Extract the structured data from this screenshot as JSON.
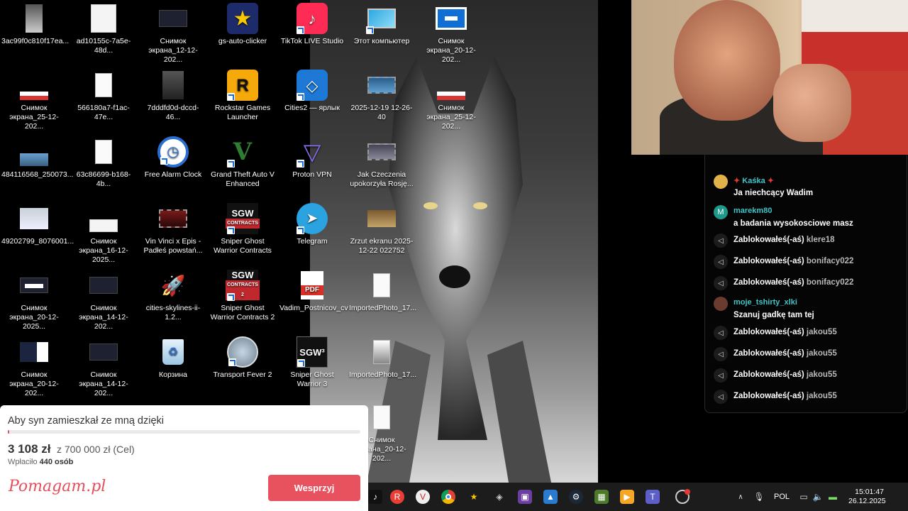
{
  "desktop": {
    "icons": [
      {
        "label": "3ac99f0c810f17ea..."
      },
      {
        "label": "ad10155c-7a5e-48d..."
      },
      {
        "label": "Снимок экрана_12-12-202..."
      },
      {
        "label": "gs-auto-clicker"
      },
      {
        "label": "TikTok LIVE Studio"
      },
      {
        "label": "Этот компьютер"
      },
      {
        "label": "Снимок экрана_20-12-202..."
      },
      {
        "label": "Снимок экрана_25-12-202..."
      },
      {
        "label": "566180a7-f1ac-47e..."
      },
      {
        "label": "7dddfd0d-dccd-46..."
      },
      {
        "label": "Rockstar Games Launcher"
      },
      {
        "label": "Cities2 — ярлык"
      },
      {
        "label": "2025-12-19 12-26-40"
      },
      {
        "label": "Снимок экрана_25-12-202..."
      },
      {
        "label": "484116568_250073..."
      },
      {
        "label": "63c86699-b168-4b..."
      },
      {
        "label": "Free Alarm Clock"
      },
      {
        "label": "Grand Theft Auto V Enhanced"
      },
      {
        "label": "Proton VPN"
      },
      {
        "label": "Jak Czeczenia upokorzyła Rosję..."
      },
      {
        "label": "49202799_8076001..."
      },
      {
        "label": "Снимок экрана_16-12-2025..."
      },
      {
        "label": "Vin Vinci x Epis - Padłeś powstań..."
      },
      {
        "label": "Sniper Ghost Warrior Contracts"
      },
      {
        "label": "Telegram"
      },
      {
        "label": "Zrzut ekranu 2025-12-22 022752"
      },
      {
        "label": "Снимок экрана_20-12-2025..."
      },
      {
        "label": "Снимок экрана_14-12-202..."
      },
      {
        "label": "cities-skylines-ii-1.2..."
      },
      {
        "label": "Sniper Ghost Warrior Contracts 2"
      },
      {
        "label": "Vadim_Postnicov_cv"
      },
      {
        "label": "ImportedPhoto_17..."
      },
      {
        "label": "Снимок экрана_20-12-202..."
      },
      {
        "label": "Снимок экрана_14-12-202..."
      },
      {
        "label": "Корзина"
      },
      {
        "label": "Transport Fever 2"
      },
      {
        "label": "Sniper Ghost Warrior 3"
      },
      {
        "label": "ImportedPhoto_17..."
      },
      {
        "label": "Снимок экрана_20-12-202..."
      }
    ]
  },
  "chat": {
    "messages": [
      {
        "kind": "msg",
        "user": "Kaśka",
        "text": "Ja niechcący Wadim",
        "avatar_color": "#e2b24a"
      },
      {
        "kind": "msg",
        "user": "marekm80",
        "text": "a badania wysokosciowe masz",
        "avatar_letter": "M",
        "avatar_color": "#1f9a8a"
      },
      {
        "kind": "sys",
        "text": "Zablokowałeś(-aś)",
        "target": "klere18"
      },
      {
        "kind": "sys",
        "text": "Zablokowałeś(-aś)",
        "target": "bonifacy022"
      },
      {
        "kind": "sys",
        "text": "Zablokowałeś(-aś)",
        "target": "bonifacy022"
      },
      {
        "kind": "msg",
        "user": "moje_tshirty_xlki",
        "text": "Szanuj gadkę tam tej",
        "avatar_color": "#6b3b2f"
      },
      {
        "kind": "sys",
        "text": "Zablokowałeś(-aś)",
        "target": "jakou55"
      },
      {
        "kind": "sys",
        "text": "Zablokowałeś(-aś)",
        "target": "jakou55"
      },
      {
        "kind": "sys",
        "text": "Zablokowałeś(-aś)",
        "target": "jakou55"
      },
      {
        "kind": "sys",
        "text": "Zablokowałeś(-aś)",
        "target": "jakou55"
      }
    ]
  },
  "donation": {
    "title": "Aby syn zamieszkał ze mną dzięki",
    "amount": "3 108 zł",
    "goal": "z 700 000 zł (Cel)",
    "paid_prefix": "Wpłaciło",
    "paid_count": "440 osób",
    "progress": 0.0044,
    "brand": "Pomagam.pl",
    "button": "Wesprzyj"
  },
  "taskbar": {
    "language": "POL",
    "time": "15:01:47",
    "date": "26.12.2025"
  }
}
